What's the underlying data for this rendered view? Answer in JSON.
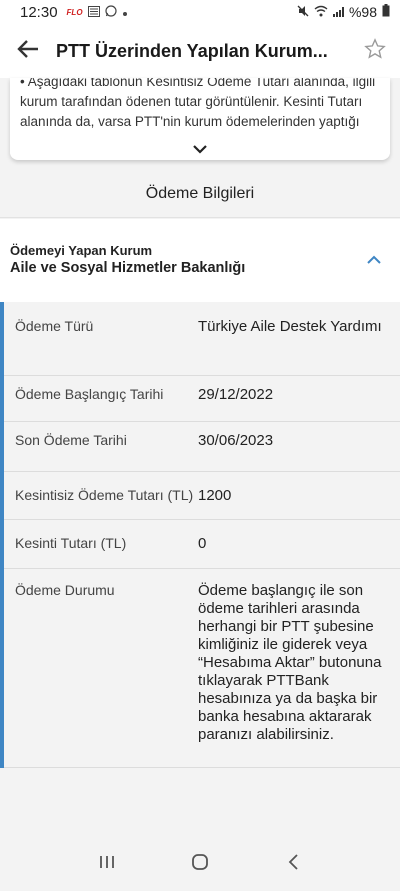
{
  "status_bar": {
    "time": "12:30",
    "app_badge": "FLO",
    "battery": "%98",
    "icons": [
      "flo-app-icon",
      "news-icon",
      "whatsapp-icon",
      "dot-icon",
      "mute-icon",
      "wifi-icon",
      "signal-icon",
      "battery-icon"
    ]
  },
  "header": {
    "title": "PTT Üzerinden Yapılan Kurum...",
    "back_icon": "arrow-left-icon",
    "favorite_icon": "star-outline-icon"
  },
  "info": {
    "text": "• Aşağıdaki tablonun Kesintisiz Ödeme Tutarı alanında, ilgili kurum tarafından ödenen tutar görüntülenir. Kesinti Tutarı alanında da, varsa PTT'nin kurum ödemelerinden yaptığı kredi kesintisi vb. tutarlar görüntülenir.",
    "expand_icon": "chevron-down-icon"
  },
  "section": {
    "title": "Ödeme Bilgileri"
  },
  "payer": {
    "label": "Ödemeyi Yapan Kurum",
    "value": "Aile ve Sosyal Hizmetler Bakanlığı",
    "collapse_icon": "chevron-up-icon"
  },
  "details": [
    {
      "label": "Ödeme Türü",
      "value": "Türkiye Aile Destek Yardımı"
    },
    {
      "label": "Ödeme Başlangıç Tarihi",
      "value": "29/12/2022"
    },
    {
      "label": "Son Ödeme Tarihi",
      "value": "30/06/2023"
    },
    {
      "label": "Kesintisiz Ödeme Tutarı (TL)",
      "value": "1200"
    },
    {
      "label": "Kesinti Tutarı (TL)",
      "value": "0"
    },
    {
      "label": "Ödeme Durumu",
      "value": "Ödeme başlangıç ile son ödeme tarihleri arasında herhangi bir PTT şubesine kimliğiniz ile giderek veya “Hesabıma Aktar” butonuna tıklayarak PTTBank hesabınıza ya da başka bir banka hesabına aktararak paranızı alabilirsiniz."
    }
  ],
  "nav_bar": {
    "icons": [
      "recent-apps-icon",
      "home-icon",
      "back-icon"
    ]
  },
  "colors": {
    "accent": "#3f86c4",
    "background": "#f3f3f3"
  }
}
